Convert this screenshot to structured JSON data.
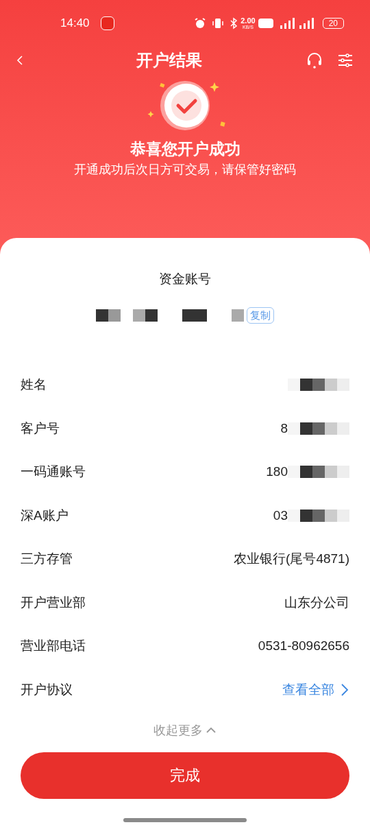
{
  "status_bar": {
    "time": "14:40",
    "speed": "2.00",
    "speed_unit": "KB/S",
    "battery": "20"
  },
  "nav": {
    "title": "开户结果"
  },
  "result": {
    "title": "恭喜您开户成功",
    "subtitle": "开通成功后次日方可交易，请保管好密码"
  },
  "account": {
    "label": "资金账号",
    "copy": "复制"
  },
  "rows": [
    {
      "label": "姓名",
      "value": "",
      "masked": true
    },
    {
      "label": "客户号",
      "value": "8",
      "masked": true
    },
    {
      "label": "一码通账号",
      "value": "180",
      "masked": true
    },
    {
      "label": "深A账户",
      "value": "03",
      "masked": true
    },
    {
      "label": "三方存管",
      "value": "农业银行(尾号4871)",
      "masked": false
    },
    {
      "label": "开户营业部",
      "value": "山东分公司",
      "masked": false
    },
    {
      "label": "营业部电话",
      "value": "0531-80962656",
      "masked": false
    },
    {
      "label": "开户协议",
      "value": "查看全部",
      "masked": false,
      "kind": "link"
    }
  ],
  "collapse": "收起更多",
  "done_button": "完成"
}
